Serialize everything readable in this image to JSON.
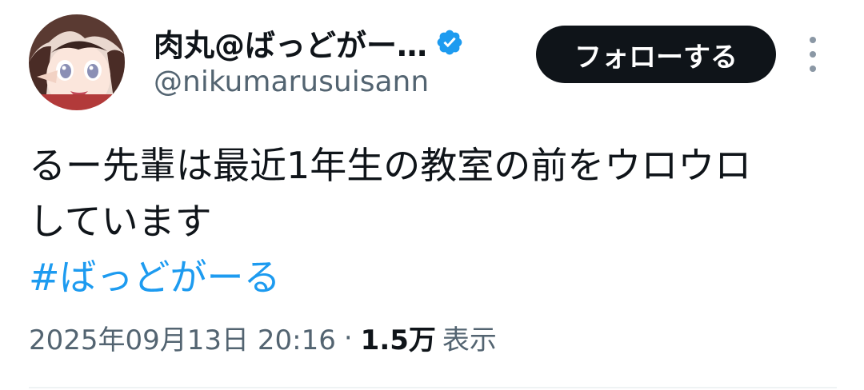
{
  "tweet": {
    "author": {
      "display_name": "肉丸@ばっどがー…",
      "handle": "@nikumarusuisann",
      "verified_icon": "verified-badge-icon"
    },
    "follow_label": "フォローする",
    "menu_icon": "more-vertical-icon",
    "text_line1": "るー先輩は最近1年生の教室の前をウロウロ",
    "text_line2": "しています",
    "hashtag": "#ばっどがーる",
    "timestamp": "2025年09月13日 20:16",
    "separator": "·",
    "views_count": "1.5万",
    "views_label": "表示"
  },
  "colors": {
    "accent": "#1d9bf0",
    "text": "#0f1419",
    "secondary": "#536471",
    "button_bg": "#0f1419"
  }
}
